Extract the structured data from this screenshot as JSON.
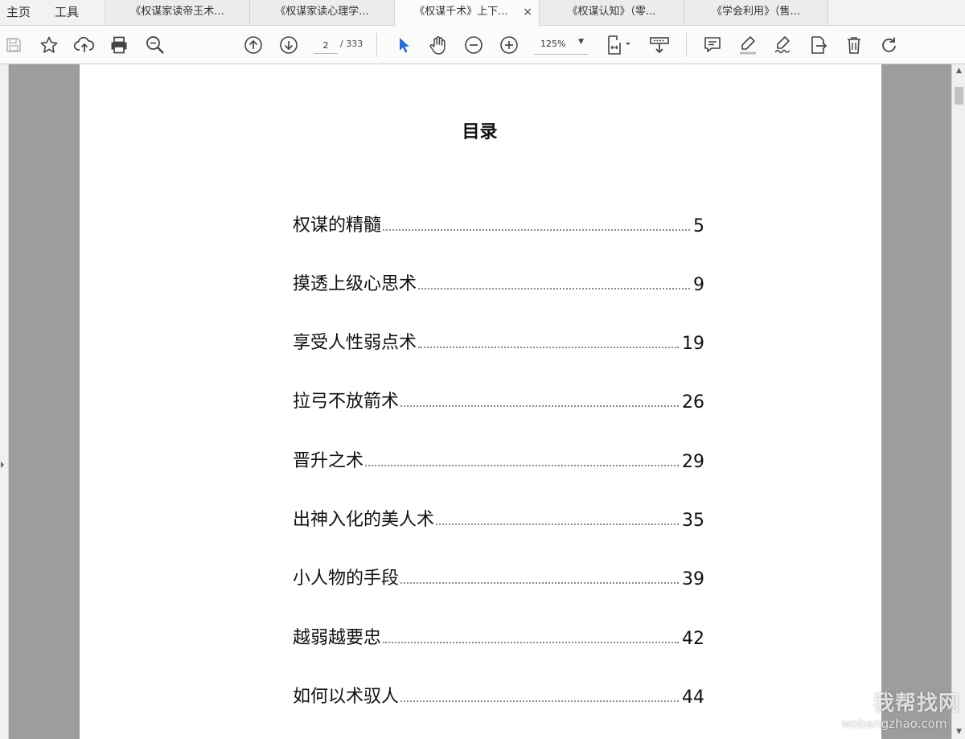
{
  "nav": {
    "home": "主页",
    "tools": "工具"
  },
  "tabs": [
    {
      "label": "《权谋家读帝王术..."
    },
    {
      "label": "《权谋家读心理学..."
    },
    {
      "label": "《权谋千术》上下...",
      "close": "×"
    },
    {
      "label": "《权谋认知》（零..."
    },
    {
      "label": "《学会利用》（售..."
    }
  ],
  "active_tab": 2,
  "toolbar": {
    "current_page": "2",
    "total_pages": "/ 333",
    "zoom": "125%",
    "zoom_caret": "▼",
    "accent_color": "#2a6fd6",
    "icons": [
      "save-icon",
      "star-icon",
      "upload-cloud-icon",
      "print-icon",
      "zoom-search-icon",
      "page-up-icon",
      "page-down-icon",
      "select-cursor-icon",
      "hand-icon",
      "zoom-out-icon",
      "zoom-in-icon",
      "page-fit-icon",
      "read-mode-icon",
      "comment-icon",
      "highlight-icon",
      "sign-icon",
      "export-icon",
      "delete-icon",
      "rotate-icon"
    ]
  },
  "document": {
    "title": "目录",
    "toc": [
      {
        "title": "权谋的精髓",
        "page": "5"
      },
      {
        "title": "摸透上级心思术",
        "page": "9"
      },
      {
        "title": "享受人性弱点术",
        "page": "19"
      },
      {
        "title": "拉弓不放箭术",
        "page": "26"
      },
      {
        "title": "晋升之术",
        "page": "29"
      },
      {
        "title": "出神入化的美人术",
        "page": "35"
      },
      {
        "title": "小人物的手段",
        "page": "39"
      },
      {
        "title": "越弱越要忠",
        "page": "42"
      },
      {
        "title": "如何以术驭人",
        "page": "44"
      }
    ]
  },
  "scrollbar": {
    "up": "▲",
    "down": "▼"
  },
  "watermark": {
    "brand": "我帮找网",
    "url": "wobangzhao.com"
  }
}
